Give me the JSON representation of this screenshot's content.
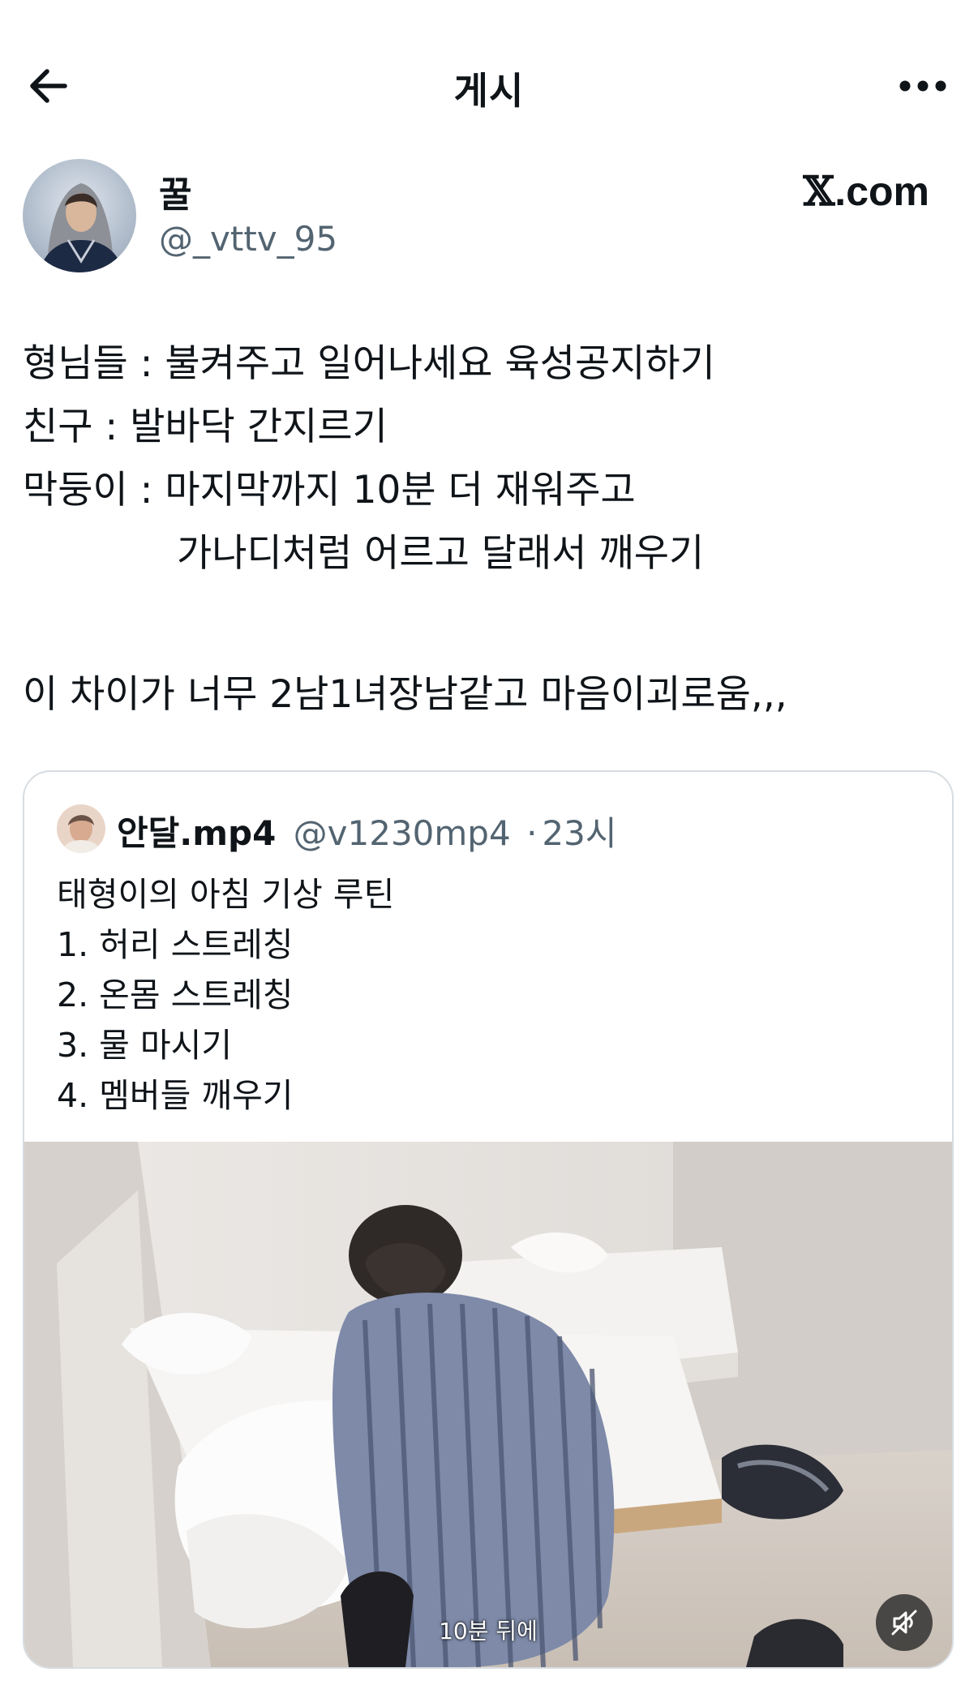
{
  "topbar": {
    "title": "게시",
    "back_icon": "arrow-left-icon",
    "more_icon": "more-horizontal-icon"
  },
  "author": {
    "name": "꿀",
    "handle": "@_vttv_95",
    "brand": "𝕏.com",
    "brand_x": "𝕏",
    "brand_rest": ".com"
  },
  "post": {
    "lines": [
      "형님들 : 불켜주고 일어나세요 육성공지하기",
      "친구 : 발바닥 간지르기",
      "막둥이 : 마지막까지 10분 더 재워주고",
      "가나디처럼 어르고 달래서 깨우기",
      "이 차이가 너무 2남1녀장남같고 마음이괴로움,,,"
    ]
  },
  "quote": {
    "name": "안달.mp4",
    "handle": "@v1230mp4",
    "separator": "·",
    "time": "23시",
    "lines": [
      "태형이의 아침 기상 루틴",
      "1. 허리 스트레칭",
      "2. 온몸 스트레칭",
      "3. 물 마시기",
      "4. 멤버들 깨우기"
    ],
    "media": {
      "caption": "10분 뒤에",
      "mute_icon": "speaker-muted-icon"
    }
  },
  "colors": {
    "text": "#0f1419",
    "secondary": "#536471",
    "border": "#d7dce0"
  }
}
